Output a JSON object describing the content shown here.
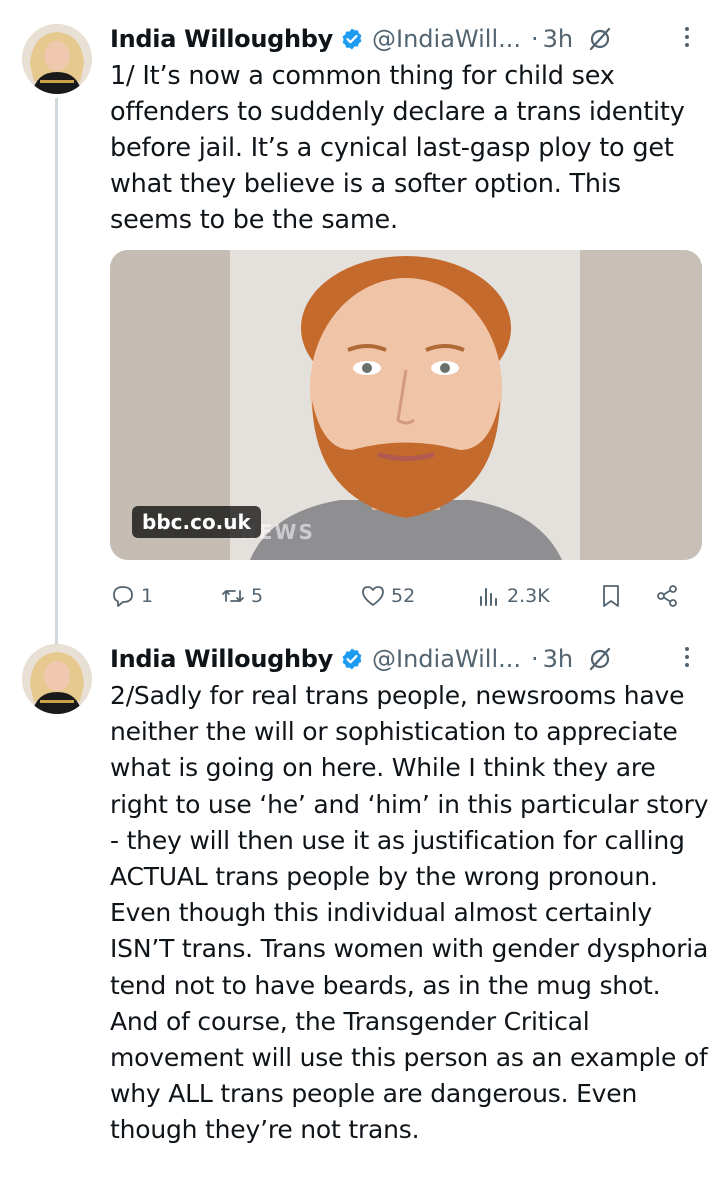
{
  "tweets": [
    {
      "author_name": "India Willoughby",
      "author_handle": "@IndiaWill...",
      "separator": "·",
      "time": "3h",
      "text": "1/ It’s now a common thing for child sex offenders to suddenly declare a trans identity before jail. It’s a cynical last-gasp ploy to get what they believe is a softer option. This seems to be the same.",
      "media": {
        "source_badge": "bbc.co.uk",
        "watermark": "NEWS"
      },
      "actions": {
        "replies": "1",
        "reposts": "5",
        "likes": "52",
        "views": "2.3K"
      }
    },
    {
      "author_name": "India Willoughby",
      "author_handle": "@IndiaWill...",
      "separator": "·",
      "time": "3h",
      "text": "2/Sadly for real trans people, newsrooms have neither the will or sophistication to appreciate what is going on here. While I think they are right to use ‘he’ and ‘him’ in this particular story - they will then use it as justification for calling ACTUAL trans people by the wrong pronoun. Even though this individual almost certainly ISN’T trans. Trans women with gender dysphoria tend not to have beards, as in the mug shot.\nAnd of course, the Transgender Critical movement will use this person as an example of why ALL trans people are dangerous. Even though they’re not trans."
    }
  ],
  "colors": {
    "verified": "#1d9bf0",
    "secondary_text": "#536471",
    "thread_line": "#cfd9de"
  }
}
